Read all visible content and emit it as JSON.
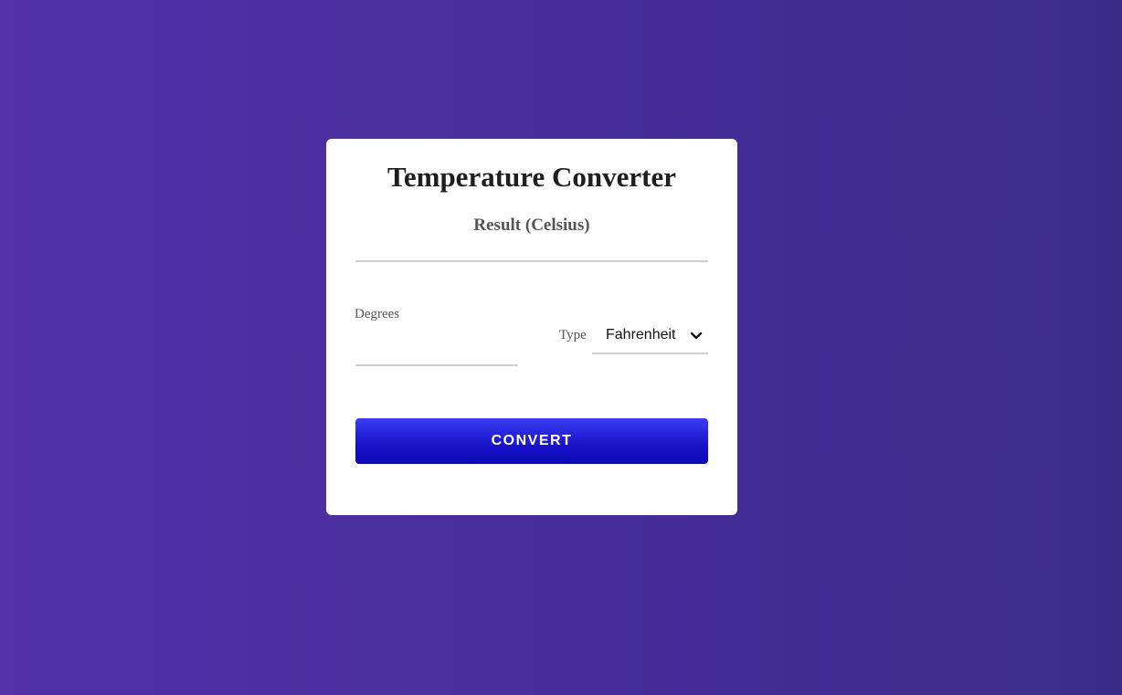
{
  "card": {
    "title": "Temperature Converter",
    "result_label": "Result (Celsius)",
    "result_value": ""
  },
  "form": {
    "degrees_label": "Degrees",
    "degrees_value": "",
    "type_label": "Type",
    "type_selected": "Fahrenheit",
    "type_icon": "chevron-down-icon",
    "convert_label": "CONVERT"
  },
  "colors": {
    "background_start": "#5231a9",
    "background_end": "#3a2b89",
    "button": "#1712c9",
    "card": "#ffffff"
  }
}
